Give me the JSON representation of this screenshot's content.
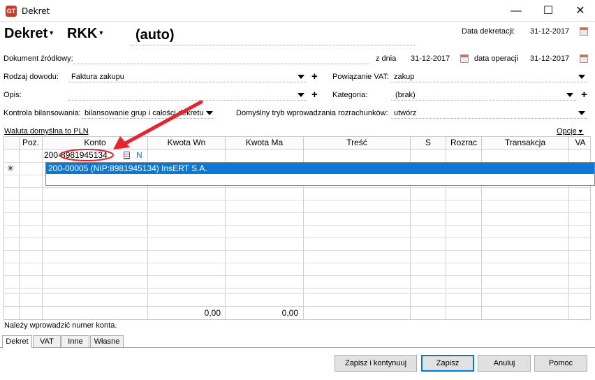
{
  "window": {
    "title": "Dekret"
  },
  "header": {
    "doc_type": "Dekret",
    "register": "RKK",
    "number": "(auto)",
    "posting_date_label": "Data dekretacji:",
    "posting_date": "31-12-2017"
  },
  "form": {
    "source_doc_label": "Dokument źródłowy:",
    "date_from_label": "z dnia",
    "date_from": "31-12-2017",
    "operation_date_label": "data operacji",
    "operation_date": "31-12-2017",
    "evidence_type_label": "Rodzaj dowodu:",
    "evidence_type": "Faktura zakupu",
    "vat_link_label": "Powiązanie VAT:",
    "vat_link": "zakup",
    "description_label": "Opis:",
    "description": "",
    "category_label": "Kategoria:",
    "category": "(brak)",
    "balance_label": "Kontrola bilansowania:",
    "balance_value": "bilansowanie grup i całości dekretu",
    "settlement_mode_label": "Domyślny tryb wprowadzania rozrachunków:",
    "settlement_mode": "utwórz",
    "currency_link": "Waluta domyślna to PLN",
    "options_label": "Opcje"
  },
  "grid": {
    "columns": [
      "Poz.",
      "Konto",
      "Kwota Wn",
      "Kwota Ma",
      "Treść",
      "S",
      "Rozrac",
      "Transakcja",
      "VA"
    ],
    "editing_account": "200-8981945134",
    "n_marker": "N",
    "new_row_marker": "✳",
    "suggestion": "200-00005 (NIP:8981945134) InsERT S.A.",
    "total_wn": "0,00",
    "total_ma": "0,00"
  },
  "status": {
    "message": "Należy wprowadzić numer konta."
  },
  "tabs": [
    "Dekret",
    "VAT",
    "Inne",
    "Własne"
  ],
  "buttons": {
    "save_continue": "Zapisz i kontynuuj",
    "save": "Zapisz",
    "cancel": "Anuluj",
    "help": "Pomoc"
  },
  "colors": {
    "selection": "#0b78d7",
    "annotation": "#e8232a",
    "n_marker": "#1f6fd0"
  }
}
